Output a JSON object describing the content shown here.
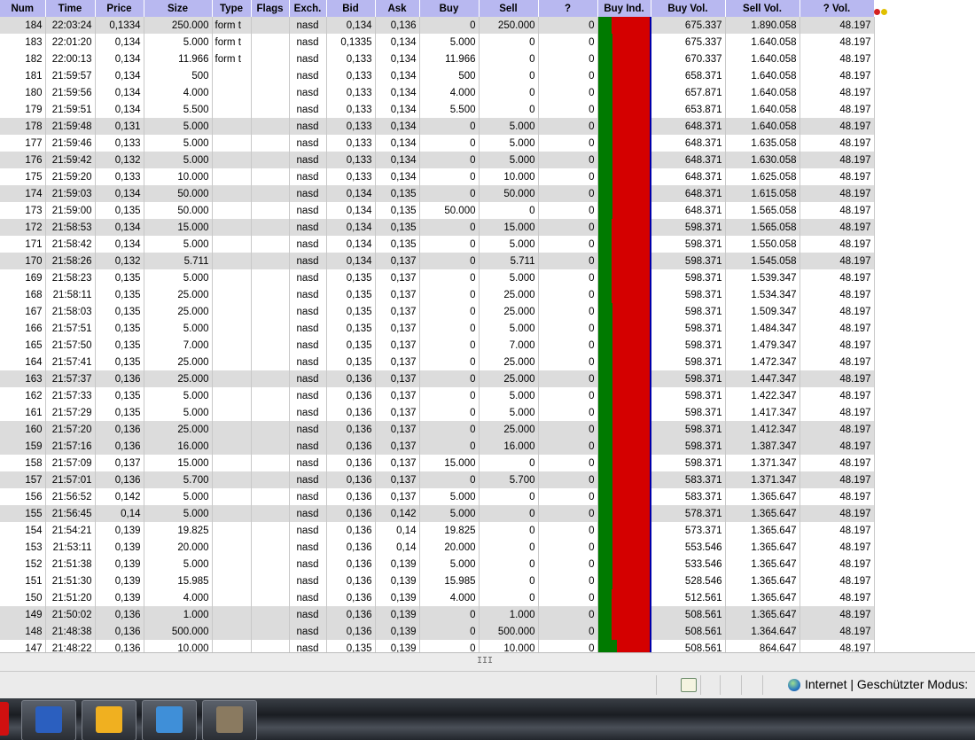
{
  "columns": [
    "Num",
    "Time",
    "Price",
    "Size",
    "Type",
    "Flags",
    "Exch.",
    "Bid",
    "Ask",
    "Buy",
    "Sell",
    "?",
    "Buy Ind.",
    "Buy Vol.",
    "Sell Vol.",
    "? Vol."
  ],
  "rows": [
    {
      "num": "184",
      "time": "22:03:24",
      "price": "0,1334",
      "size": "250.000",
      "type": "form t",
      "flags": "",
      "exch": "nasd",
      "bid": "0,134",
      "ask": "0,136",
      "buy": "0",
      "sell": "250.000",
      "q": "0",
      "buyvol": "675.337",
      "sellvol": "1.890.058",
      "qvol": "48.197",
      "shade": true,
      "ind": 0.27
    },
    {
      "num": "183",
      "time": "22:01:20",
      "price": "0,134",
      "size": "5.000",
      "type": "form t",
      "flags": "",
      "exch": "nasd",
      "bid": "0,1335",
      "ask": "0,134",
      "buy": "5.000",
      "sell": "0",
      "q": "0",
      "buyvol": "675.337",
      "sellvol": "1.640.058",
      "qvol": "48.197",
      "shade": false,
      "ind": 0.29
    },
    {
      "num": "182",
      "time": "22:00:13",
      "price": "0,134",
      "size": "11.966",
      "type": "form t",
      "flags": "",
      "exch": "nasd",
      "bid": "0,133",
      "ask": "0,134",
      "buy": "11.966",
      "sell": "0",
      "q": "0",
      "buyvol": "670.337",
      "sellvol": "1.640.058",
      "qvol": "48.197",
      "shade": false,
      "ind": 0.29
    },
    {
      "num": "181",
      "time": "21:59:57",
      "price": "0,134",
      "size": "500",
      "type": "",
      "flags": "",
      "exch": "nasd",
      "bid": "0,133",
      "ask": "0,134",
      "buy": "500",
      "sell": "0",
      "q": "0",
      "buyvol": "658.371",
      "sellvol": "1.640.058",
      "qvol": "48.197",
      "shade": false,
      "ind": 0.29
    },
    {
      "num": "180",
      "time": "21:59:56",
      "price": "0,134",
      "size": "4.000",
      "type": "",
      "flags": "",
      "exch": "nasd",
      "bid": "0,133",
      "ask": "0,134",
      "buy": "4.000",
      "sell": "0",
      "q": "0",
      "buyvol": "657.871",
      "sellvol": "1.640.058",
      "qvol": "48.197",
      "shade": false,
      "ind": 0.29
    },
    {
      "num": "179",
      "time": "21:59:51",
      "price": "0,134",
      "size": "5.500",
      "type": "",
      "flags": "",
      "exch": "nasd",
      "bid": "0,133",
      "ask": "0,134",
      "buy": "5.500",
      "sell": "0",
      "q": "0",
      "buyvol": "653.871",
      "sellvol": "1.640.058",
      "qvol": "48.197",
      "shade": false,
      "ind": 0.29
    },
    {
      "num": "178",
      "time": "21:59:48",
      "price": "0,131",
      "size": "5.000",
      "type": "",
      "flags": "",
      "exch": "nasd",
      "bid": "0,133",
      "ask": "0,134",
      "buy": "0",
      "sell": "5.000",
      "q": "0",
      "buyvol": "648.371",
      "sellvol": "1.640.058",
      "qvol": "48.197",
      "shade": true,
      "ind": 0.28
    },
    {
      "num": "177",
      "time": "21:59:46",
      "price": "0,133",
      "size": "5.000",
      "type": "",
      "flags": "",
      "exch": "nasd",
      "bid": "0,133",
      "ask": "0,134",
      "buy": "0",
      "sell": "5.000",
      "q": "0",
      "buyvol": "648.371",
      "sellvol": "1.635.058",
      "qvol": "48.197",
      "shade": false,
      "ind": 0.28
    },
    {
      "num": "176",
      "time": "21:59:42",
      "price": "0,132",
      "size": "5.000",
      "type": "",
      "flags": "",
      "exch": "nasd",
      "bid": "0,133",
      "ask": "0,134",
      "buy": "0",
      "sell": "5.000",
      "q": "0",
      "buyvol": "648.371",
      "sellvol": "1.630.058",
      "qvol": "48.197",
      "shade": true,
      "ind": 0.28
    },
    {
      "num": "175",
      "time": "21:59:20",
      "price": "0,133",
      "size": "10.000",
      "type": "",
      "flags": "",
      "exch": "nasd",
      "bid": "0,133",
      "ask": "0,134",
      "buy": "0",
      "sell": "10.000",
      "q": "0",
      "buyvol": "648.371",
      "sellvol": "1.625.058",
      "qvol": "48.197",
      "shade": false,
      "ind": 0.28
    },
    {
      "num": "174",
      "time": "21:59:03",
      "price": "0,134",
      "size": "50.000",
      "type": "",
      "flags": "",
      "exch": "nasd",
      "bid": "0,134",
      "ask": "0,135",
      "buy": "0",
      "sell": "50.000",
      "q": "0",
      "buyvol": "648.371",
      "sellvol": "1.615.058",
      "qvol": "48.197",
      "shade": true,
      "ind": 0.28
    },
    {
      "num": "173",
      "time": "21:59:00",
      "price": "0,135",
      "size": "50.000",
      "type": "",
      "flags": "",
      "exch": "nasd",
      "bid": "0,134",
      "ask": "0,135",
      "buy": "50.000",
      "sell": "0",
      "q": "0",
      "buyvol": "648.371",
      "sellvol": "1.565.058",
      "qvol": "48.197",
      "shade": false,
      "ind": 0.29
    },
    {
      "num": "172",
      "time": "21:58:53",
      "price": "0,134",
      "size": "15.000",
      "type": "",
      "flags": "",
      "exch": "nasd",
      "bid": "0,134",
      "ask": "0,135",
      "buy": "0",
      "sell": "15.000",
      "q": "0",
      "buyvol": "598.371",
      "sellvol": "1.565.058",
      "qvol": "48.197",
      "shade": true,
      "ind": 0.27
    },
    {
      "num": "171",
      "time": "21:58:42",
      "price": "0,134",
      "size": "5.000",
      "type": "",
      "flags": "",
      "exch": "nasd",
      "bid": "0,134",
      "ask": "0,135",
      "buy": "0",
      "sell": "5.000",
      "q": "0",
      "buyvol": "598.371",
      "sellvol": "1.550.058",
      "qvol": "48.197",
      "shade": false,
      "ind": 0.27
    },
    {
      "num": "170",
      "time": "21:58:26",
      "price": "0,132",
      "size": "5.711",
      "type": "",
      "flags": "",
      "exch": "nasd",
      "bid": "0,134",
      "ask": "0,137",
      "buy": "0",
      "sell": "5.711",
      "q": "0",
      "buyvol": "598.371",
      "sellvol": "1.545.058",
      "qvol": "48.197",
      "shade": true,
      "ind": 0.27
    },
    {
      "num": "169",
      "time": "21:58:23",
      "price": "0,135",
      "size": "5.000",
      "type": "",
      "flags": "",
      "exch": "nasd",
      "bid": "0,135",
      "ask": "0,137",
      "buy": "0",
      "sell": "5.000",
      "q": "0",
      "buyvol": "598.371",
      "sellvol": "1.539.347",
      "qvol": "48.197",
      "shade": false,
      "ind": 0.27
    },
    {
      "num": "168",
      "time": "21:58:11",
      "price": "0,135",
      "size": "25.000",
      "type": "",
      "flags": "",
      "exch": "nasd",
      "bid": "0,135",
      "ask": "0,137",
      "buy": "0",
      "sell": "25.000",
      "q": "0",
      "buyvol": "598.371",
      "sellvol": "1.534.347",
      "qvol": "48.197",
      "shade": false,
      "ind": 0.27
    },
    {
      "num": "167",
      "time": "21:58:03",
      "price": "0,135",
      "size": "25.000",
      "type": "",
      "flags": "",
      "exch": "nasd",
      "bid": "0,135",
      "ask": "0,137",
      "buy": "0",
      "sell": "25.000",
      "q": "0",
      "buyvol": "598.371",
      "sellvol": "1.509.347",
      "qvol": "48.197",
      "shade": false,
      "ind": 0.28
    },
    {
      "num": "166",
      "time": "21:57:51",
      "price": "0,135",
      "size": "5.000",
      "type": "",
      "flags": "",
      "exch": "nasd",
      "bid": "0,135",
      "ask": "0,137",
      "buy": "0",
      "sell": "5.000",
      "q": "0",
      "buyvol": "598.371",
      "sellvol": "1.484.347",
      "qvol": "48.197",
      "shade": false,
      "ind": 0.28
    },
    {
      "num": "165",
      "time": "21:57:50",
      "price": "0,135",
      "size": "7.000",
      "type": "",
      "flags": "",
      "exch": "nasd",
      "bid": "0,135",
      "ask": "0,137",
      "buy": "0",
      "sell": "7.000",
      "q": "0",
      "buyvol": "598.371",
      "sellvol": "1.479.347",
      "qvol": "48.197",
      "shade": false,
      "ind": 0.28
    },
    {
      "num": "164",
      "time": "21:57:41",
      "price": "0,135",
      "size": "25.000",
      "type": "",
      "flags": "",
      "exch": "nasd",
      "bid": "0,135",
      "ask": "0,137",
      "buy": "0",
      "sell": "25.000",
      "q": "0",
      "buyvol": "598.371",
      "sellvol": "1.472.347",
      "qvol": "48.197",
      "shade": false,
      "ind": 0.28
    },
    {
      "num": "163",
      "time": "21:57:37",
      "price": "0,136",
      "size": "25.000",
      "type": "",
      "flags": "",
      "exch": "nasd",
      "bid": "0,136",
      "ask": "0,137",
      "buy": "0",
      "sell": "25.000",
      "q": "0",
      "buyvol": "598.371",
      "sellvol": "1.447.347",
      "qvol": "48.197",
      "shade": true,
      "ind": 0.28
    },
    {
      "num": "162",
      "time": "21:57:33",
      "price": "0,135",
      "size": "5.000",
      "type": "",
      "flags": "",
      "exch": "nasd",
      "bid": "0,136",
      "ask": "0,137",
      "buy": "0",
      "sell": "5.000",
      "q": "0",
      "buyvol": "598.371",
      "sellvol": "1.422.347",
      "qvol": "48.197",
      "shade": false,
      "ind": 0.28
    },
    {
      "num": "161",
      "time": "21:57:29",
      "price": "0,135",
      "size": "5.000",
      "type": "",
      "flags": "",
      "exch": "nasd",
      "bid": "0,136",
      "ask": "0,137",
      "buy": "0",
      "sell": "5.000",
      "q": "0",
      "buyvol": "598.371",
      "sellvol": "1.417.347",
      "qvol": "48.197",
      "shade": false,
      "ind": 0.28
    },
    {
      "num": "160",
      "time": "21:57:20",
      "price": "0,136",
      "size": "25.000",
      "type": "",
      "flags": "",
      "exch": "nasd",
      "bid": "0,136",
      "ask": "0,137",
      "buy": "0",
      "sell": "25.000",
      "q": "0",
      "buyvol": "598.371",
      "sellvol": "1.412.347",
      "qvol": "48.197",
      "shade": true,
      "ind": 0.28
    },
    {
      "num": "159",
      "time": "21:57:16",
      "price": "0,136",
      "size": "16.000",
      "type": "",
      "flags": "",
      "exch": "nasd",
      "bid": "0,136",
      "ask": "0,137",
      "buy": "0",
      "sell": "16.000",
      "q": "0",
      "buyvol": "598.371",
      "sellvol": "1.387.347",
      "qvol": "48.197",
      "shade": true,
      "ind": 0.28
    },
    {
      "num": "158",
      "time": "21:57:09",
      "price": "0,137",
      "size": "15.000",
      "type": "",
      "flags": "",
      "exch": "nasd",
      "bid": "0,136",
      "ask": "0,137",
      "buy": "15.000",
      "sell": "0",
      "q": "0",
      "buyvol": "598.371",
      "sellvol": "1.371.347",
      "qvol": "48.197",
      "shade": false,
      "ind": 0.29
    },
    {
      "num": "157",
      "time": "21:57:01",
      "price": "0,136",
      "size": "5.700",
      "type": "",
      "flags": "",
      "exch": "nasd",
      "bid": "0,136",
      "ask": "0,137",
      "buy": "0",
      "sell": "5.700",
      "q": "0",
      "buyvol": "583.371",
      "sellvol": "1.371.347",
      "qvol": "48.197",
      "shade": true,
      "ind": 0.28
    },
    {
      "num": "156",
      "time": "21:56:52",
      "price": "0,142",
      "size": "5.000",
      "type": "",
      "flags": "",
      "exch": "nasd",
      "bid": "0,136",
      "ask": "0,137",
      "buy": "5.000",
      "sell": "0",
      "q": "0",
      "buyvol": "583.371",
      "sellvol": "1.365.647",
      "qvol": "48.197",
      "shade": false,
      "ind": 0.29
    },
    {
      "num": "155",
      "time": "21:56:45",
      "price": "0,14",
      "size": "5.000",
      "type": "",
      "flags": "",
      "exch": "nasd",
      "bid": "0,136",
      "ask": "0,142",
      "buy": "5.000",
      "sell": "0",
      "q": "0",
      "buyvol": "578.371",
      "sellvol": "1.365.647",
      "qvol": "48.197",
      "shade": true,
      "ind": 0.29
    },
    {
      "num": "154",
      "time": "21:54:21",
      "price": "0,139",
      "size": "19.825",
      "type": "",
      "flags": "",
      "exch": "nasd",
      "bid": "0,136",
      "ask": "0,14",
      "buy": "19.825",
      "sell": "0",
      "q": "0",
      "buyvol": "573.371",
      "sellvol": "1.365.647",
      "qvol": "48.197",
      "shade": false,
      "ind": 0.29
    },
    {
      "num": "153",
      "time": "21:53:11",
      "price": "0,139",
      "size": "20.000",
      "type": "",
      "flags": "",
      "exch": "nasd",
      "bid": "0,136",
      "ask": "0,14",
      "buy": "20.000",
      "sell": "0",
      "q": "0",
      "buyvol": "553.546",
      "sellvol": "1.365.647",
      "qvol": "48.197",
      "shade": false,
      "ind": 0.29
    },
    {
      "num": "152",
      "time": "21:51:38",
      "price": "0,139",
      "size": "5.000",
      "type": "",
      "flags": "",
      "exch": "nasd",
      "bid": "0,136",
      "ask": "0,139",
      "buy": "5.000",
      "sell": "0",
      "q": "0",
      "buyvol": "533.546",
      "sellvol": "1.365.647",
      "qvol": "48.197",
      "shade": false,
      "ind": 0.28
    },
    {
      "num": "151",
      "time": "21:51:30",
      "price": "0,139",
      "size": "15.985",
      "type": "",
      "flags": "",
      "exch": "nasd",
      "bid": "0,136",
      "ask": "0,139",
      "buy": "15.985",
      "sell": "0",
      "q": "0",
      "buyvol": "528.546",
      "sellvol": "1.365.647",
      "qvol": "48.197",
      "shade": false,
      "ind": 0.28
    },
    {
      "num": "150",
      "time": "21:51:20",
      "price": "0,139",
      "size": "4.000",
      "type": "",
      "flags": "",
      "exch": "nasd",
      "bid": "0,136",
      "ask": "0,139",
      "buy": "4.000",
      "sell": "0",
      "q": "0",
      "buyvol": "512.561",
      "sellvol": "1.365.647",
      "qvol": "48.197",
      "shade": false,
      "ind": 0.27
    },
    {
      "num": "149",
      "time": "21:50:02",
      "price": "0,136",
      "size": "1.000",
      "type": "",
      "flags": "",
      "exch": "nasd",
      "bid": "0,136",
      "ask": "0,139",
      "buy": "0",
      "sell": "1.000",
      "q": "0",
      "buyvol": "508.561",
      "sellvol": "1.365.647",
      "qvol": "48.197",
      "shade": true,
      "ind": 0.27
    },
    {
      "num": "148",
      "time": "21:48:38",
      "price": "0,136",
      "size": "500.000",
      "type": "",
      "flags": "",
      "exch": "nasd",
      "bid": "0,136",
      "ask": "0,139",
      "buy": "0",
      "sell": "500.000",
      "q": "0",
      "buyvol": "508.561",
      "sellvol": "1.364.647",
      "qvol": "48.197",
      "shade": true,
      "ind": 0.27
    },
    {
      "num": "147",
      "time": "21:48:22",
      "price": "0,136",
      "size": "10.000",
      "type": "",
      "flags": "",
      "exch": "nasd",
      "bid": "0,135",
      "ask": "0,139",
      "buy": "0",
      "sell": "10.000",
      "q": "0",
      "buyvol": "508.561",
      "sellvol": "864.647",
      "qvol": "48.197",
      "shade": false,
      "ind": 0.37
    }
  ],
  "scrollbar": {
    "thumb": "III"
  },
  "statusbar": {
    "zone": "Internet | Geschützter Modus:",
    "zone_icon": "globe-icon",
    "addon_icon": "certificate-icon"
  },
  "taskbar": {
    "apps": [
      {
        "name": "word",
        "icon": "word-icon",
        "color": "#2b5fbf"
      },
      {
        "name": "outlook",
        "icon": "outlook-icon",
        "color": "#f0b020"
      },
      {
        "name": "photos",
        "icon": "photo-viewer-icon",
        "color": "#3f8fd8"
      },
      {
        "name": "gimp",
        "icon": "gimp-icon",
        "color": "#8a7a60"
      }
    ]
  },
  "colors": {
    "buy": "#007a00",
    "sell": "#d40000",
    "header": "#b8b8f0",
    "shade": "#dcdcdc"
  }
}
